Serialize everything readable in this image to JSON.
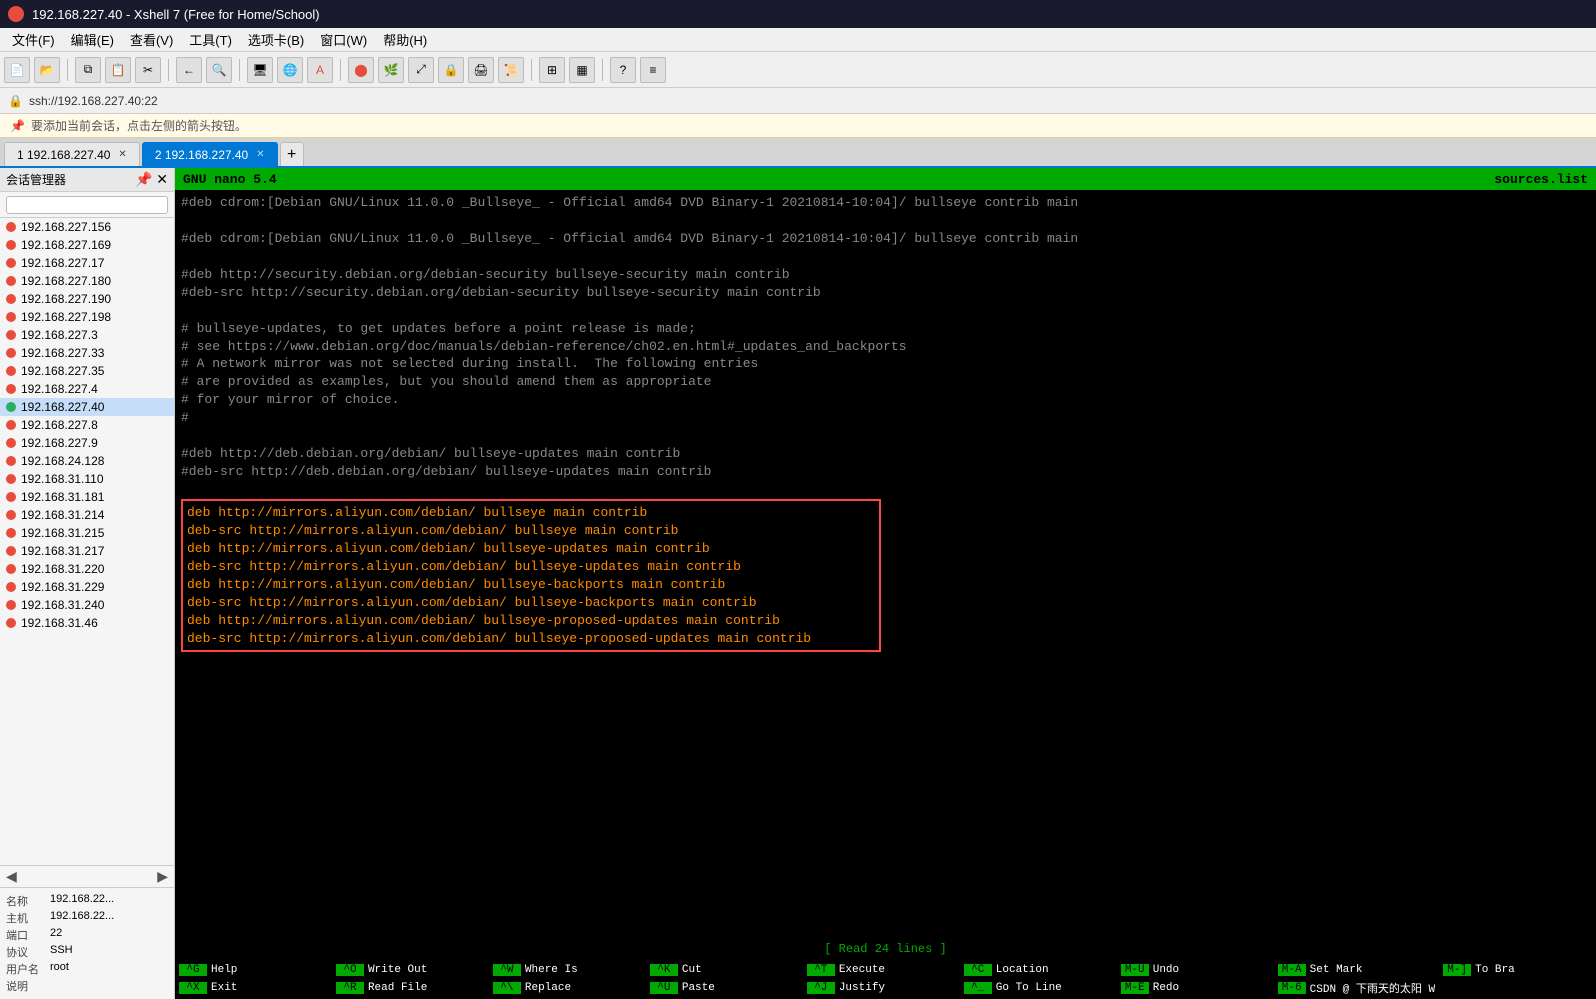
{
  "window": {
    "title": "192.168.227.40 - Xshell 7 (Free for Home/School)",
    "address": "ssh://192.168.227.40:22",
    "info_banner": "要添加当前会话，点击左侧的箭头按钮。"
  },
  "menubar": {
    "items": [
      "文件(F)",
      "编辑(E)",
      "查看(V)",
      "工具(T)",
      "选项卡(B)",
      "窗口(W)",
      "帮助(H)"
    ]
  },
  "tabs": [
    {
      "id": "tab1",
      "label": "1  192.168.227.40",
      "active": false
    },
    {
      "id": "tab2",
      "label": "2  192.168.227.40",
      "active": true
    }
  ],
  "sidebar": {
    "title": "会话管理器",
    "search_placeholder": "",
    "items": [
      "192.168.227.156",
      "192.168.227.169",
      "192.168.227.17",
      "192.168.227.180",
      "192.168.227.190",
      "192.168.227.198",
      "192.168.227.3",
      "192.168.227.33",
      "192.168.227.35",
      "192.168.227.4",
      "192.168.227.40",
      "192.168.227.8",
      "192.168.227.9",
      "192.168.24.128",
      "192.168.31.110",
      "192.168.31.181",
      "192.168.31.214",
      "192.168.31.215",
      "192.168.31.217",
      "192.168.31.220",
      "192.168.31.229",
      "192.168.31.240",
      "192.168.31.46"
    ],
    "active_item": "192.168.227.40"
  },
  "bottom_panel": {
    "rows": [
      {
        "label": "名称",
        "value": "192.168.22..."
      },
      {
        "label": "主机",
        "value": "192.168.22..."
      },
      {
        "label": "端口",
        "value": "22"
      },
      {
        "label": "协议",
        "value": "SSH"
      },
      {
        "label": "用户名",
        "value": "root"
      },
      {
        "label": "说明",
        "value": ""
      }
    ]
  },
  "nano": {
    "header_left": "GNU nano 5.4",
    "header_right": "sources.list",
    "status": "[ Read 24 lines ]",
    "content_lines": [
      {
        "type": "comment",
        "text": "#deb cdrom:[Debian GNU/Linux 11.0.0 _Bullseye_ - Official amd64 DVD Binary-1 20210814-10:04]/ bullseye contrib main"
      },
      {
        "type": "blank",
        "text": ""
      },
      {
        "type": "comment",
        "text": "#deb cdrom:[Debian GNU/Linux 11.0.0 _Bullseye_ - Official amd64 DVD Binary-1 20210814-10:04]/ bullseye contrib main"
      },
      {
        "type": "blank",
        "text": ""
      },
      {
        "type": "comment",
        "text": "#deb http://security.debian.org/debian-security bullseye-security main contrib"
      },
      {
        "type": "comment",
        "text": "#deb-src http://security.debian.org/debian-security bullseye-security main contrib"
      },
      {
        "type": "blank",
        "text": ""
      },
      {
        "type": "comment",
        "text": "# bullseye-updates, to get updates before a point release is made;"
      },
      {
        "type": "comment",
        "text": "# see https://www.debian.org/doc/manuals/debian-reference/ch02.en.html#_updates_and_backports"
      },
      {
        "type": "comment",
        "text": "# A network mirror was not selected during install.  The following entries"
      },
      {
        "type": "comment",
        "text": "# are provided as examples, but you should amend them as appropriate"
      },
      {
        "type": "comment",
        "text": "# for your mirror of choice."
      },
      {
        "type": "comment",
        "text": "#"
      },
      {
        "type": "blank",
        "text": ""
      },
      {
        "type": "comment",
        "text": "#deb http://deb.debian.org/debian/ bullseye-updates main contrib"
      },
      {
        "type": "comment",
        "text": "#deb-src http://deb.debian.org/debian/ bullseye-updates main contrib"
      },
      {
        "type": "blank",
        "text": ""
      },
      {
        "type": "highlight",
        "lines": [
          "deb http://mirrors.aliyun.com/debian/ bullseye main contrib",
          "deb-src http://mirrors.aliyun.com/debian/ bullseye main contrib",
          "deb http://mirrors.aliyun.com/debian/ bullseye-updates main contrib",
          "deb-src http://mirrors.aliyun.com/debian/ bullseye-updates main contrib",
          "deb http://mirrors.aliyun.com/debian/ bullseye-backports main contrib",
          "deb-src http://mirrors.aliyun.com/debian/ bullseye-backports main contrib",
          "deb http://mirrors.aliyun.com/debian/ bullseye-proposed-updates main contrib",
          "deb-src http://mirrors.aliyun.com/debian/ bullseye-proposed-updates main contrib"
        ]
      }
    ],
    "shortcuts": [
      [
        {
          "key": "^G",
          "label": "Help"
        },
        {
          "key": "^X",
          "label": "Exit"
        }
      ],
      [
        {
          "key": "^O",
          "label": "Write Out"
        },
        {
          "key": "^R",
          "label": "Read File"
        }
      ],
      [
        {
          "key": "^W",
          "label": "Where Is"
        },
        {
          "key": "^\\",
          "label": "Replace"
        }
      ],
      [
        {
          "key": "^K",
          "label": "Cut"
        },
        {
          "key": "^U",
          "label": "Paste"
        }
      ],
      [
        {
          "key": "^T",
          "label": "Execute"
        },
        {
          "key": "^J",
          "label": "Justify"
        }
      ],
      [
        {
          "key": "^C",
          "label": "Location"
        },
        {
          "key": "^_",
          "label": "Go To Line"
        }
      ],
      [
        {
          "key": "M-U",
          "label": "Undo"
        },
        {
          "key": "M-E",
          "label": "Redo"
        }
      ],
      [
        {
          "key": "M-A",
          "label": "Set Mark"
        },
        {
          "key": "M-6",
          "label": "CSDN @ 下雨天的太阳 W"
        }
      ],
      [
        {
          "key": "M-]",
          "label": "To Bra"
        },
        {
          "key": "",
          "label": ""
        }
      ]
    ]
  }
}
